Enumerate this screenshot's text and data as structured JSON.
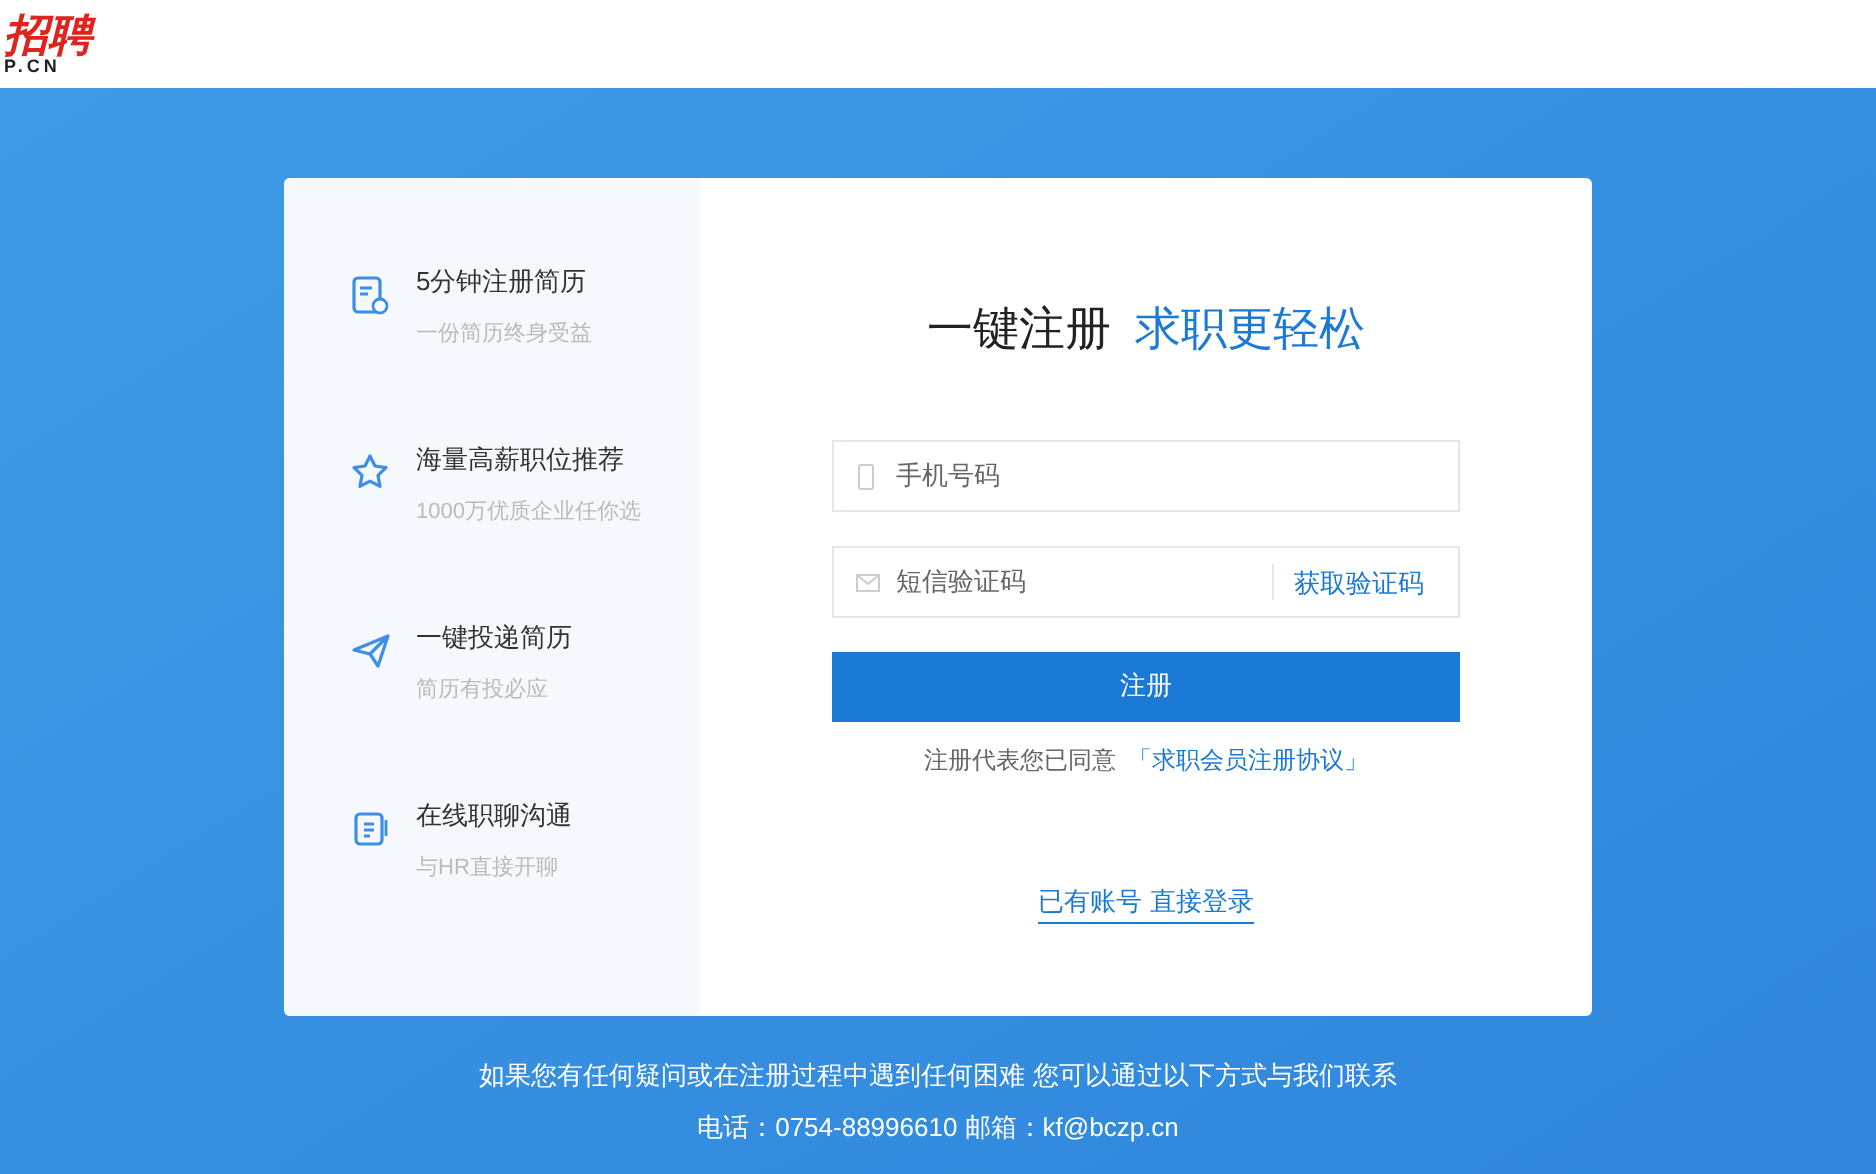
{
  "header": {
    "logo_text": "招聘",
    "logo_subtext": "P.CN"
  },
  "features": [
    {
      "kind": "resume",
      "title": "5分钟注册简历",
      "subtitle": "一份简历终身受益"
    },
    {
      "kind": "star",
      "title": "海量高薪职位推荐",
      "subtitle": "1000万优质企业任你选"
    },
    {
      "kind": "send",
      "title": "一键投递简历",
      "subtitle": "简历有投必应"
    },
    {
      "kind": "chat",
      "title": "在线职聊沟通",
      "subtitle": "与HR直接开聊"
    }
  ],
  "form": {
    "heading": "一键注册",
    "heading_accent": "求职更轻松",
    "phone": {
      "placeholder": "手机号码"
    },
    "code": {
      "placeholder": "短信验证码",
      "action": "获取验证码"
    },
    "submit": "注册",
    "agreement_text": "注册代表您已同意",
    "agreement_link": "「求职会员注册协议」",
    "login_link": "已有账号 直接登录"
  },
  "footer": {
    "line_1": "如果您有任何疑问或在注册过程中遇到任何困难 您可以通过以下方式与我们联系",
    "line_2": "电话：0754-88996610 邮箱：kf@bczp.cn"
  }
}
